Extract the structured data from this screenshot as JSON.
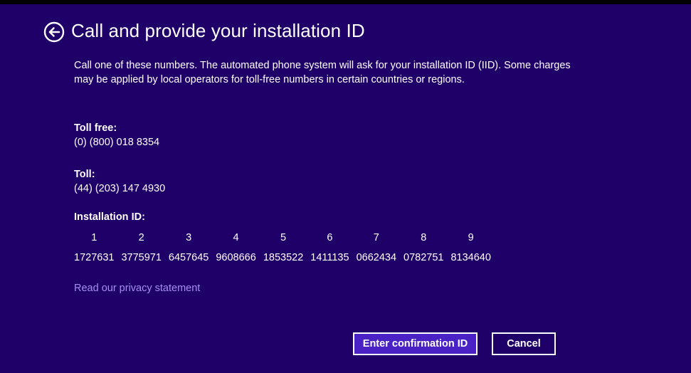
{
  "header": {
    "title": "Call and provide your installation ID",
    "back_icon": "back-arrow-circle-icon"
  },
  "description": "Call one of these numbers. The automated phone system will ask for your installation ID (IID). Some charges may be applied by local operators for toll-free numbers in certain countries or regions.",
  "toll_free": {
    "label": "Toll free:",
    "number": "(0) (800) 018 8354"
  },
  "toll": {
    "label": "Toll:",
    "number": "(44) (203) 147 4930"
  },
  "installation_id": {
    "label": "Installation ID:",
    "groups": [
      {
        "index": "1",
        "value": "1727631"
      },
      {
        "index": "2",
        "value": "3775971"
      },
      {
        "index": "3",
        "value": "6457645"
      },
      {
        "index": "4",
        "value": "9608666"
      },
      {
        "index": "5",
        "value": "1853522"
      },
      {
        "index": "6",
        "value": "1411135"
      },
      {
        "index": "7",
        "value": "0662434"
      },
      {
        "index": "8",
        "value": "0782751"
      },
      {
        "index": "9",
        "value": "8134640"
      }
    ]
  },
  "privacy_link": "Read our privacy statement",
  "buttons": {
    "enter_confirmation": "Enter confirmation ID",
    "cancel": "Cancel"
  },
  "colors": {
    "background": "#1f0068",
    "primary_button": "#4a21c4",
    "link": "#a48ef0",
    "text": "#ffffff"
  }
}
